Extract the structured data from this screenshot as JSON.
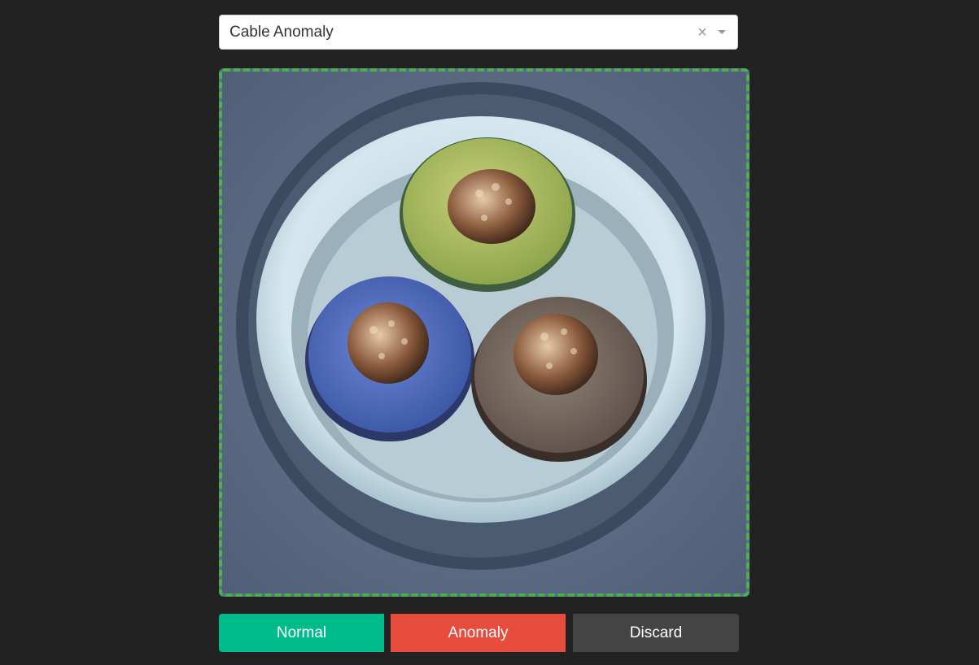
{
  "dropdown": {
    "selected": "Cable Anomaly",
    "clear_icon": "×"
  },
  "image": {
    "subject": "cable-cross-section",
    "frame_color": "#4caf50"
  },
  "buttons": {
    "normal": "Normal",
    "anomaly": "Anomaly",
    "discard": "Discard"
  },
  "colors": {
    "normal": "#00bc8c",
    "anomaly": "#e74c3c",
    "discard": "#444444",
    "background": "#222222"
  }
}
